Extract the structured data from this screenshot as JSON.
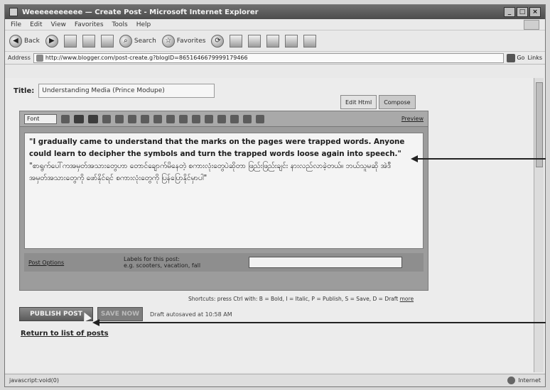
{
  "window": {
    "title": "Weeeeeeeeeee — Create Post - Microsoft Internet Explorer",
    "controls": [
      "_",
      "□",
      "×"
    ]
  },
  "menu": [
    "File",
    "Edit",
    "View",
    "Favorites",
    "Tools",
    "Help"
  ],
  "toolbar": {
    "back": "Back",
    "search": "Search",
    "favorites": "Favorites"
  },
  "address": {
    "label": "Address",
    "url": "http://www.blogger.com/post-create.g?blogID=8651646679999179466",
    "go": "Go",
    "links": "Links"
  },
  "post": {
    "title_label": "Title:",
    "title_value": "Understanding Media (Prince Modupe)",
    "tabs": [
      "Edit Html",
      "Compose"
    ],
    "font_select": "Font",
    "preview": "Preview",
    "body_english": "\"I gradually came to understand that the marks on the pages were trapped words. Anyone could learn to decipher the symbols and turn the trapped words loose again into speech.\"",
    "body_burmese": "\"စာရွက်ပေါ်ကအမှတ်အသားတွေဟာ တောင်ချောက်မိနေတဲ့ စကားလုံးတွေပဲဆိုတာ ဖြည်းဖြည်းချင်း နားလည်လာခဲ့တယ်။ ဘယ်သူမဆို အဲဒီအမှတ်အသားတွေကို ဖော်နိုင်ရင် စကားလုံးတွေကို ပြန်ပြောနိုင်မှာပါ\"",
    "post_options": "Post Options",
    "labels_title": "Labels for this post:",
    "labels_hint": "e.g. scooters, vacation, fall",
    "shortcuts": "Shortcuts: press Ctrl with: B = Bold, I = Italic, P = Publish, S = Save, D = Draft",
    "shortcuts_more": "more",
    "publish": "PUBLISH POST",
    "save": "SAVE NOW",
    "draft_note": "Draft autosaved at 10:58 AM",
    "return": "Return to list of posts"
  },
  "status": {
    "left": "javascript:void(0)",
    "zone": "Internet"
  }
}
